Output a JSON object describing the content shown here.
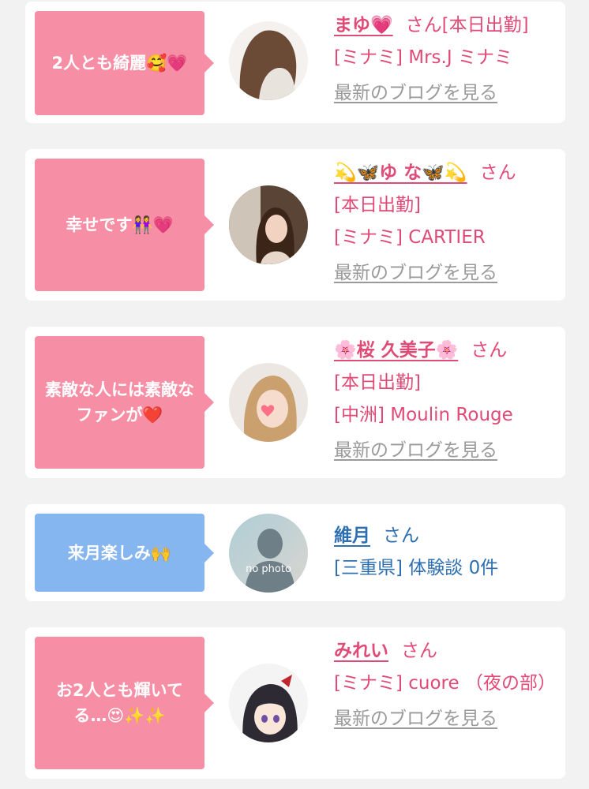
{
  "cards": [
    {
      "bubble": "2人とも綺麗🥰💗",
      "name": "まゆ💗",
      "san": "さん",
      "lines": [
        "[本日出勤]",
        "[ミナミ] Mrs.J ミナミ"
      ],
      "blog_link": "最新のブログを見る"
    },
    {
      "bubble": "幸せです👭💗",
      "name": "💫🦋ゆ な🦋💫",
      "san": "さん",
      "lines": [
        "[本日出勤]",
        "[ミナミ] CARTIER"
      ],
      "blog_link": "最新のブログを見る"
    },
    {
      "bubble": "素敵な人には素敵なファンが❤️",
      "name": "🌸桜 久美子🌸",
      "san": "さん",
      "lines": [
        "[本日出勤]",
        "[中洲] Moulin Rouge"
      ],
      "blog_link": "最新のブログを見る"
    },
    {
      "bubble": "来月楽しみ🙌",
      "name": "維月",
      "san": "さん",
      "lines": [
        "[三重県] 体験談 0件"
      ],
      "avatar_text": "no photo"
    },
    {
      "bubble": "お2人とも輝いてる…😍✨✨",
      "name": "みれい",
      "san": "さん",
      "lines": [
        "[ミナミ] cuore （夜の部）"
      ],
      "blog_link": "最新のブログを見る"
    }
  ],
  "colors": {
    "pink": "#f68fa5",
    "blue": "#86b6ef",
    "pink_text": "#e04a76",
    "blue_text": "#2d6fb0"
  }
}
